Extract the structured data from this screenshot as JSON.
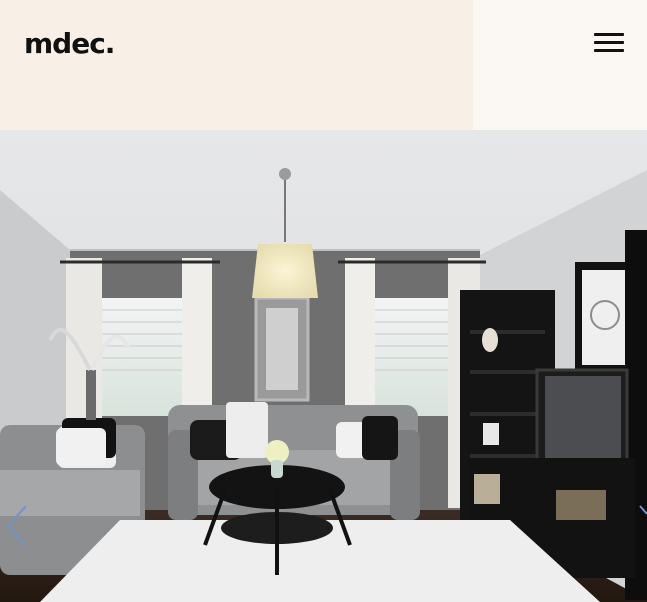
{
  "header": {
    "logo_text": "mdec."
  },
  "icons": {
    "menu": "hamburger-menu-icon",
    "prev": "chevron-left-icon",
    "next": "chevron-right-icon"
  },
  "colors": {
    "header_left_bg": "#f8efe6",
    "header_right_bg": "#fbf8f4",
    "text": "#111111",
    "slider_arrow": "#6f95c9"
  },
  "hero": {
    "image": "living-room-photo"
  }
}
